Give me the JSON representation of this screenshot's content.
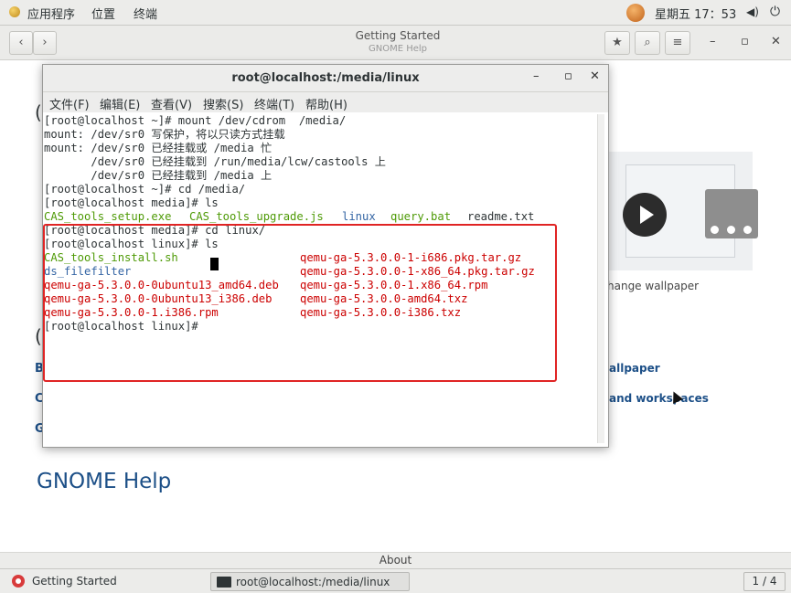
{
  "top_bar": {
    "menus": [
      "应用程序",
      "位置",
      "终端"
    ],
    "clock": "星期五 17：53"
  },
  "help_window": {
    "title": "Getting Started",
    "subtitle": "GNOME Help",
    "caption_wallpaper": "hange wallpaper",
    "link_wallpaper": "allpaper",
    "link_workspaces": "and workspaces",
    "gnome_help": "GNOME Help",
    "about": "About",
    "edge_letters": [
      "(",
      "(",
      "B",
      "C",
      "G"
    ]
  },
  "terminal": {
    "title": "root@localhost:/media/linux",
    "menu": [
      "文件(F)",
      "编辑(E)",
      "查看(V)",
      "搜索(S)",
      "终端(T)",
      "帮助(H)"
    ],
    "lines": [
      "[root@localhost ~]# mount /dev/cdrom  /media/",
      "mount: /dev/sr0 写保护，将以只读方式挂载",
      "mount: /dev/sr0 已经挂载或 /media 忙",
      "       /dev/sr0 已经挂载到 /run/media/lcw/castools 上",
      "       /dev/sr0 已经挂载到 /media 上",
      "[root@localhost ~]# cd /media/",
      "[root@localhost media]# ls"
    ],
    "ls_media": [
      "CAS_tools_setup.exe",
      "CAS_tools_upgrade.js",
      "linux",
      "query.bat",
      "readme.txt"
    ],
    "cd_linux": "[root@localhost media]# cd linux/",
    "ls_cmd": "[root@localhost linux]# ls",
    "ls_linux_left": [
      "CAS_tools_install.sh",
      "ds_filefilter",
      "qemu-ga-5.3.0.0-0ubuntu13_amd64.deb",
      "qemu-ga-5.3.0.0-0ubuntu13_i386.deb",
      "qemu-ga-5.3.0.0-1.i386.rpm"
    ],
    "ls_linux_right": [
      "qemu-ga-5.3.0.0-1-i686.pkg.tar.gz",
      "qemu-ga-5.3.0.0-1-x86_64.pkg.tar.gz",
      "qemu-ga-5.3.0.0-1.x86_64.rpm",
      "qemu-ga-5.3.0.0-amd64.txz",
      "qemu-ga-5.3.0.0-i386.txz"
    ],
    "prompt": "[root@localhost linux]# "
  },
  "bottom_panel": {
    "task_help": "Getting Started",
    "task_terminal": "root@localhost:/media/linux",
    "workspace": "1 / 4"
  },
  "colors": {
    "highlight": "#e02424",
    "exec_green": "#4e9a06",
    "dir_blue": "#3465a4",
    "archive_red": "#cc0000"
  }
}
